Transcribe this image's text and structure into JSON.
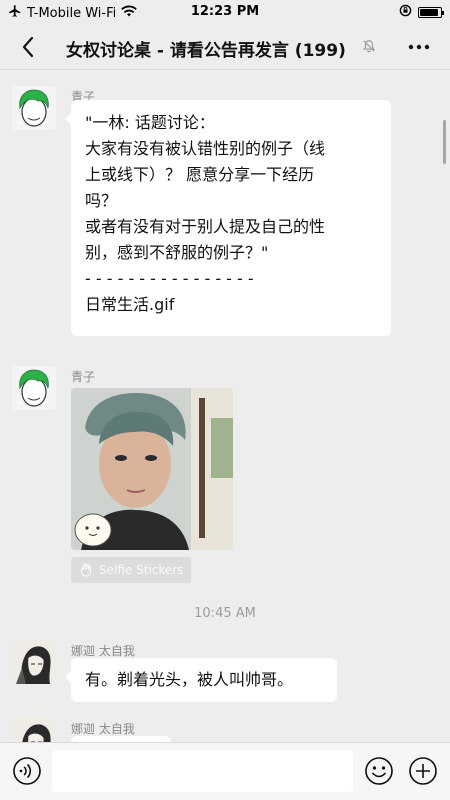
{
  "status_bar": {
    "carrier": "T-Mobile Wi-Fi",
    "time": "12:23 PM"
  },
  "nav": {
    "title": "女权讨论桌 - 请看公告再发言 (199)"
  },
  "messages": [
    {
      "sender": "青子",
      "lines": [
        "\"一林: 话题讨论：",
        "",
        "大家有没有被认错性别的例子（线",
        "上或线下）？ 愿意分享一下经历",
        "吗？",
        "",
        "或者有没有对于别人提及自己的性",
        "别，感到不舒服的例子？\"",
        "- - - - - - - - - - - - - - - -",
        "日常生活.gif"
      ]
    },
    {
      "sender": "青子",
      "sticker_label": "Selfie Stickers"
    },
    {
      "timestamp": "10:45 AM"
    },
    {
      "sender": "娜迦 太自我",
      "text": "有。剃着光头，被人叫帅哥。"
    },
    {
      "sender": "娜迦 太自我"
    }
  ],
  "input": {
    "value": ""
  },
  "colors": {
    "background": "#ededed",
    "bubble": "#ffffff",
    "sender": "#8a8a8a"
  }
}
